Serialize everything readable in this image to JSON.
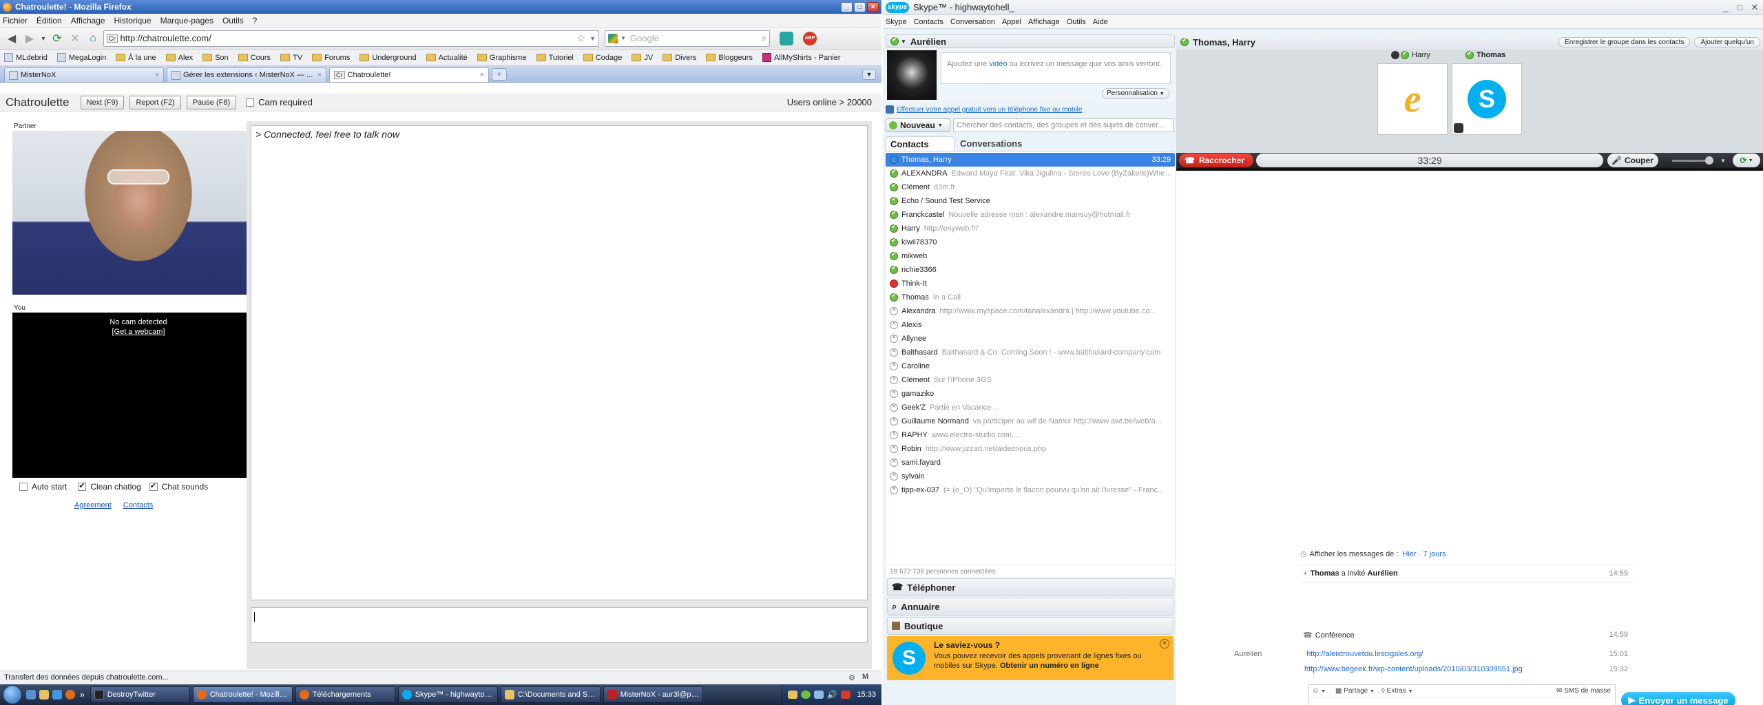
{
  "firefox": {
    "window_title": "Chatroulette! - Mozilla Firefox",
    "menu": [
      "Fichier",
      "Édition",
      "Affichage",
      "Historique",
      "Marque-pages",
      "Outils",
      "?"
    ],
    "url": "http://chatroulette.com/",
    "url_favicon": "Cr",
    "search_placeholder": "Google",
    "bookmarks": [
      "MLdebrid",
      "MegaLogin",
      "À la une",
      "Alex",
      "Son",
      "Cours",
      "TV",
      "Forums",
      "Underground",
      "Actualité",
      "Graphisme",
      "Tutoriel",
      "Codage",
      "JV",
      "Divers",
      "Bloggeurs",
      "AllMyShirts - Panier"
    ],
    "tabs": [
      {
        "label": "MisterNoX"
      },
      {
        "label": "Gérer les extensions ‹ MisterNoX — ..."
      },
      {
        "label": "Chatroulette!"
      }
    ],
    "status": "Transfert des données depuis chatroulette.com..."
  },
  "chatroulette": {
    "logo": "Chatroulette",
    "next_label": "Next (F9)",
    "report_label": "Report (F2)",
    "pause_label": "Pause (F8)",
    "cam_required_label": "Cam required",
    "users_online": "Users online > 20000",
    "partner_label": "Partner",
    "you_label": "You",
    "no_cam": "No cam detected",
    "get_webcam": "[Get a webcam]",
    "auto_start": "Auto start",
    "clean_chatlog": "Clean chatlog",
    "chat_sounds": "Chat sounds",
    "agreement": "Agreement",
    "contacts": "Contacts",
    "chat_log": "> Connected, feel free to talk now"
  },
  "taskbar": {
    "items": [
      "DestroyTwitter",
      "Chatroulette! - Mozilla...",
      "Téléchargements",
      "Skype™ - highwaytoh...",
      "C:\\Documents and Se...",
      "MisterNoX - aur3l@psi..."
    ],
    "clock": "15:33"
  },
  "skype": {
    "window_title": "Skype™ - highwaytohell_",
    "menu": [
      "Skype",
      "Contacts",
      "Conversation",
      "Appel",
      "Affichage",
      "Outils",
      "Aide"
    ],
    "profile_name": "Aurélien",
    "mood_placeholder_a": "Ajoutez une ",
    "mood_placeholder_link": "vidéo",
    "mood_placeholder_b": " ou écrivez un message que vos amis verront.",
    "personalize": "Personnalisation",
    "free_call": "Effectuer votre appel gratuit vers un téléphone fixe ou mobile",
    "new_label": "Nouveau",
    "search_placeholder": "Chercher des contacts, des groupes et des sujets de conver...",
    "tab_contacts": "Contacts",
    "tab_conversations": "Conversations",
    "contacts": [
      {
        "name": "Thomas, Harry",
        "mood": "",
        "status": "call",
        "time": "33:29"
      },
      {
        "name": "ALEXANDRA",
        "mood": "Edward Maya Feat. Vika Jigulina - Stereo Love (ByZakelis)When ...",
        "status": "online"
      },
      {
        "name": "Clément",
        "mood": "d3m.fr",
        "status": "online"
      },
      {
        "name": "Echo / Sound Test Service",
        "mood": "",
        "status": "online"
      },
      {
        "name": "Franckcastel",
        "mood": "Nouvelle adresse msn : alexandre.mansuy@hotmail.fr",
        "status": "online"
      },
      {
        "name": "Harry",
        "mood": "http://enyweb.fr/",
        "status": "online"
      },
      {
        "name": "kiwii78370",
        "mood": "",
        "status": "online"
      },
      {
        "name": "mikweb",
        "mood": "",
        "status": "online"
      },
      {
        "name": "richie3366",
        "mood": "",
        "status": "online"
      },
      {
        "name": "Think-It",
        "mood": "",
        "status": "busy"
      },
      {
        "name": "Thomas",
        "mood": "In a Call",
        "status": "online"
      },
      {
        "name": "Alexandra",
        "mood": "http://www.myspace.com/tanalexandra | http://www.youtube.co...",
        "status": "offline"
      },
      {
        "name": "Alexis",
        "mood": "",
        "status": "offline"
      },
      {
        "name": "Allynee",
        "mood": "",
        "status": "offline"
      },
      {
        "name": "Balthasard",
        "mood": "Balthasard & Co. Coming Soon ! - www.balthasard-company.com",
        "status": "offline"
      },
      {
        "name": "Caroline",
        "mood": "",
        "status": "offline"
      },
      {
        "name": "Clément",
        "mood": "Sur l'iPhone 3GS",
        "status": "offline"
      },
      {
        "name": "gamaziko",
        "mood": "",
        "status": "offline"
      },
      {
        "name": "Geek'Z",
        "mood": "Partie en Vacance ...",
        "status": "offline"
      },
      {
        "name": "Guillaume Normand",
        "mood": "va participer au wif de Namur http://www.awt.be/web/a...",
        "status": "offline"
      },
      {
        "name": "RAPHY",
        "mood": "www.electro-studio.com....",
        "status": "offline"
      },
      {
        "name": "Robin",
        "mood": "http://www.jizzart.net/aideznous.php",
        "status": "offline"
      },
      {
        "name": "sami.fayard",
        "mood": "",
        "status": "offline"
      },
      {
        "name": "sylvain",
        "mood": "",
        "status": "offline"
      },
      {
        "name": "tipp-ex-037",
        "mood": "(= (o_O) \"Qu'importe le flacon pourvu qu'on ait l'ivresse\" - Franc...",
        "status": "offline"
      }
    ],
    "connected_count": "19 672 736 personnes connectées",
    "section_phone": "Téléphoner",
    "section_directory": "Annuaire",
    "section_shop": "Boutique",
    "tip_title": "Le saviez-vous ?",
    "tip_text": "Vous pouvez recevoir des appels provenant de lignes fixes ou mobiles sur Skype.",
    "tip_link": "Obtenir un numéro en ligne",
    "call_title": "Thomas, Harry",
    "save_group": "Enregistrer le groupe dans les contacts",
    "add_someone": "Ajouter quelqu'un",
    "participant_1": "Harry",
    "participant_2": "Thomas",
    "hangup": "Raccrocher",
    "call_timer": "33:29",
    "mute": "Couper",
    "history_prefix": "Afficher les messages de :",
    "history_yesterday": "Hier",
    "history_7days": "7 jours",
    "messages": [
      {
        "sender": "",
        "bold_a": "Thomas",
        "text": " a invité ",
        "bold_b": "Aurélien",
        "time": "14:59"
      },
      {
        "sender": "",
        "bold_a": "",
        "text": "Conférence",
        "bold_b": "",
        "time": "14:59"
      },
      {
        "sender": "Aurélien",
        "link": "http://aleixtrouvetou.lescigales.org/",
        "time": "15:01"
      },
      {
        "sender": "",
        "link": "http://www.begeek.fr/wp-content/uploads/2010/03/310309551.jpg",
        "time": "15:32"
      }
    ],
    "share_label": "Partage",
    "extras_label": "Extras",
    "sms_label": "SMS de masse",
    "send_label": "Envoyer un message"
  },
  "colors": {
    "skype_blue": "#00aff0",
    "hangup_red": "#d42a1f",
    "online_green": "#6fbe44"
  }
}
